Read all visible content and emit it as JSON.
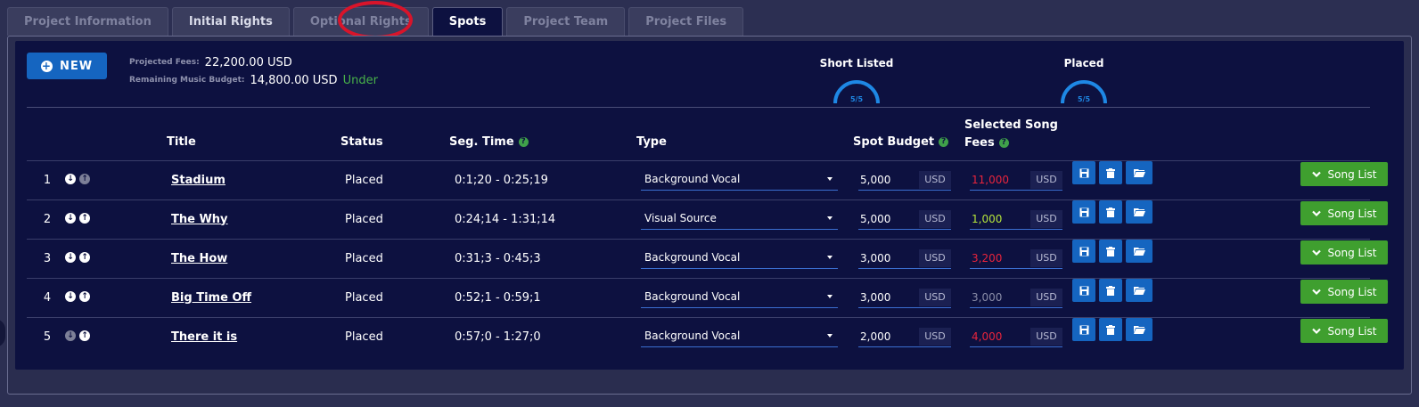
{
  "tabs": [
    {
      "label": "Project Information"
    },
    {
      "label": "Initial Rights"
    },
    {
      "label": "Optional Rights"
    },
    {
      "label": "Spots"
    },
    {
      "label": "Project Team"
    },
    {
      "label": "Project Files"
    }
  ],
  "active_tab": "Spots",
  "toolbar": {
    "new_label": "NEW"
  },
  "fees": {
    "projected_label": "Projected Fees:",
    "projected_value": "22,200.00 USD",
    "remaining_label": "Remaining Music Budget:",
    "remaining_value": "14,800.00 USD",
    "remaining_status": "Under"
  },
  "gauges": [
    {
      "title": "Short Listed",
      "value": "5/5",
      "fraction": 1.0
    },
    {
      "title": "Placed",
      "value": "5/5",
      "fraction": 1.0
    }
  ],
  "columns": {
    "title": "Title",
    "status": "Status",
    "seg_time": "Seg. Time",
    "type": "Type",
    "spot_budget": "Spot Budget",
    "song_fees_1": "Selected Song",
    "song_fees_2": "Fees"
  },
  "help_glyph": "?",
  "currency": "USD",
  "song_list_label": "Song List",
  "rows": [
    {
      "index": "1",
      "title": "Stadium",
      "status": "Placed",
      "seg_time": "0:1;20 - 0:25;19",
      "type": "Background Vocal",
      "budget": "5,000",
      "fees": "11,000",
      "fees_state": "over",
      "up_enabled": false,
      "down_enabled": true
    },
    {
      "index": "2",
      "title": "The Why",
      "status": "Placed",
      "seg_time": "0:24;14 - 1:31;14",
      "type": "Visual Source",
      "budget": "5,000",
      "fees": "1,000",
      "fees_state": "under",
      "up_enabled": true,
      "down_enabled": true
    },
    {
      "index": "3",
      "title": "The How",
      "status": "Placed",
      "seg_time": "0:31;3 - 0:45;3",
      "type": "Background Vocal",
      "budget": "3,000",
      "fees": "3,200",
      "fees_state": "over",
      "up_enabled": true,
      "down_enabled": true
    },
    {
      "index": "4",
      "title": "Big Time Off",
      "status": "Placed",
      "seg_time": "0:52;1 - 0:59;1",
      "type": "Background Vocal",
      "budget": "3,000",
      "fees": "3,000",
      "fees_state": "equal",
      "up_enabled": true,
      "down_enabled": true
    },
    {
      "index": "5",
      "title": "There it is",
      "status": "Placed",
      "seg_time": "0:57;0 - 1:27;0",
      "type": "Background Vocal",
      "budget": "2,000",
      "fees": "4,000",
      "fees_state": "over",
      "up_enabled": true,
      "down_enabled": false
    }
  ],
  "colors": {
    "accent": "#1565c0",
    "success": "#3f9f2f",
    "over": "#e8243c",
    "under": "#b5e53a",
    "equal": "#8a8da8",
    "highlight": "#d9142a"
  }
}
